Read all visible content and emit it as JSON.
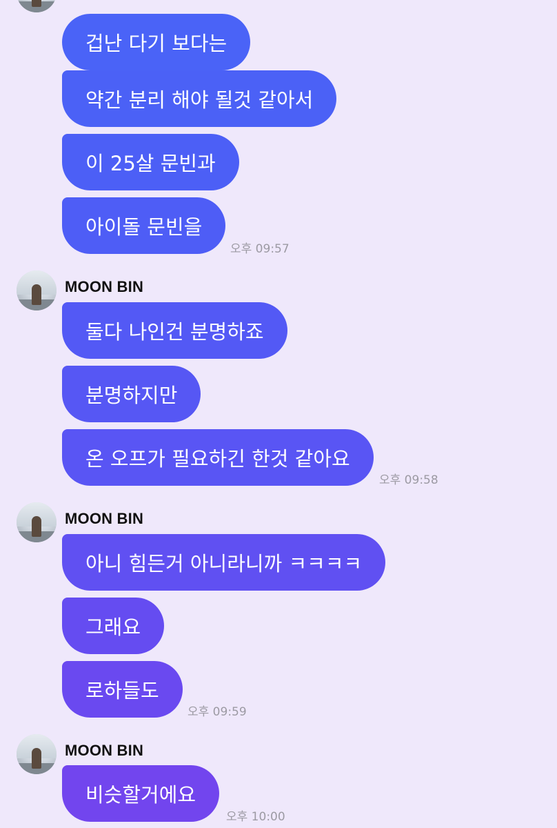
{
  "chat": {
    "groups": [
      {
        "sender": "",
        "messages": [
          "겁난 다기 보다는",
          "약간 분리 해야 될것 같아서",
          "이 25살 문빈과",
          "아이돌 문빈을"
        ],
        "time": "오후 09:57"
      },
      {
        "sender": "MOON BIN",
        "messages": [
          "둘다 나인건 분명하죠",
          "분명하지만",
          "온 오프가 필요하긴 한것 같아요"
        ],
        "time": "오후 09:58"
      },
      {
        "sender": "MOON BIN",
        "messages": [
          "아니 힘든거 아니라니까 ㅋㅋㅋㅋ",
          "그래요",
          "로하들도"
        ],
        "time": "오후 09:59"
      },
      {
        "sender": "MOON BIN",
        "messages": [
          "비슷할거에요"
        ],
        "time": "오후 10:00"
      }
    ]
  },
  "colors": {
    "background": "#efe8fb",
    "bubble_top": "#4a63f7",
    "bubble_bottom": "#7a45ee",
    "time_text": "#9c9aa3"
  },
  "icons": {
    "avatar": "profile-photo-avatar"
  }
}
